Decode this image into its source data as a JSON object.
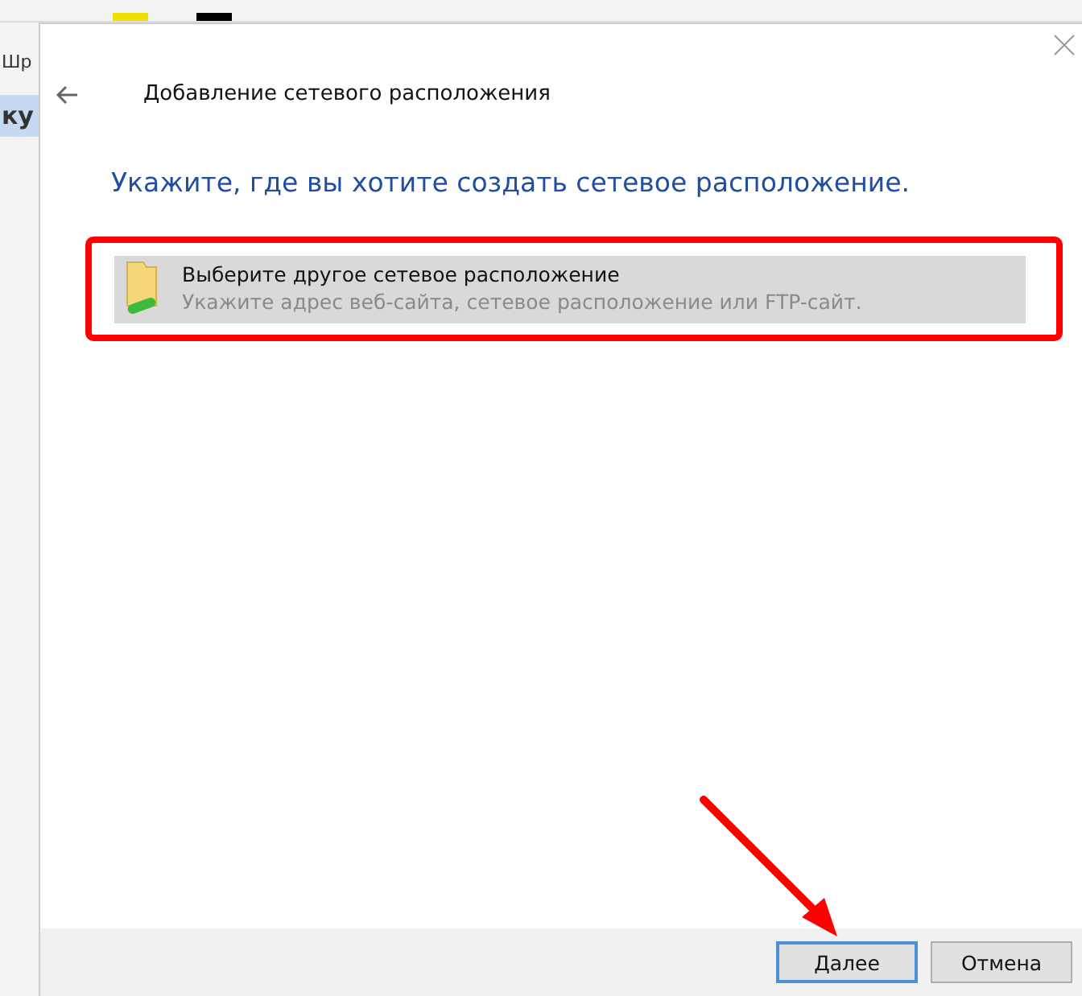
{
  "background_app": {
    "side_labels": [
      "Шр",
      "ку"
    ]
  },
  "dialog": {
    "title": "Добавление сетевого расположения",
    "heading": "Укажите, где вы хотите создать сетевое расположение.",
    "options": [
      {
        "title": "Выберите другое сетевое расположение",
        "description": "Укажите адрес веб-сайта, сетевое расположение или FTP-сайт.",
        "selected": true
      }
    ],
    "buttons": [
      {
        "label": "Далее",
        "kind": "default"
      },
      {
        "label": "Отмена",
        "kind": "normal"
      }
    ]
  }
}
